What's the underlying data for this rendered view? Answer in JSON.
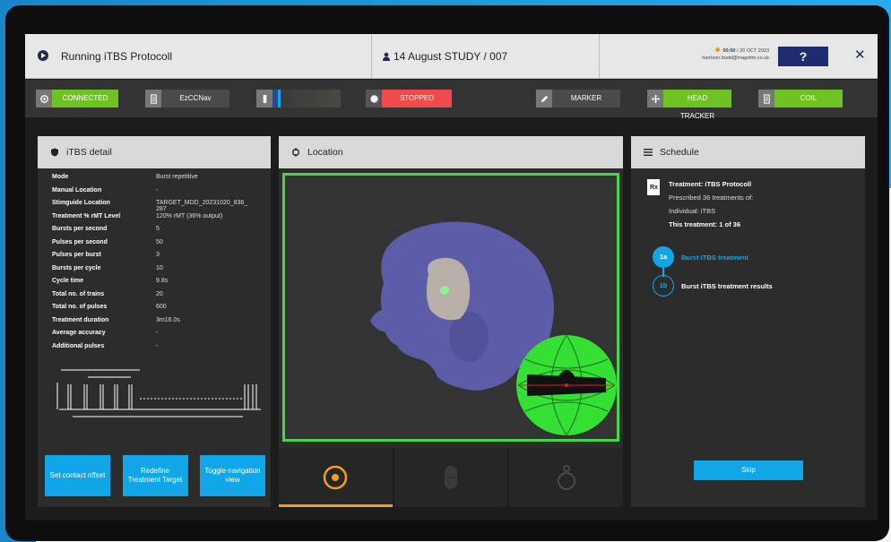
{
  "titlebar": {
    "title": "Running iTBS Protocoll",
    "study": "14 August STUDY / 007",
    "time": "00:50",
    "date": "20 OCT 2023",
    "email": "harrison.budd@magstim.co.uk",
    "help": "?",
    "close": "✕"
  },
  "statusbar": {
    "connected": "CONNECTED",
    "nav": "EzCCNav",
    "stopped": "STOPPED",
    "marker": "MARKER",
    "head_tracker": "HEAD TRACKER",
    "coil": "COIL",
    "colors": {
      "green": "#6ec222",
      "red": "#f04a4a",
      "dark": "#4a4a4a"
    }
  },
  "itbs": {
    "header": "iTBS detail",
    "rows": [
      {
        "k": "Mode",
        "v": "Burst repetitive"
      },
      {
        "k": "Manual Location",
        "v": "-"
      },
      {
        "k": "Stimguide Location",
        "v": "TARGET_MDD_20231020_836_ 287"
      },
      {
        "k": "Treatment % rMT Level",
        "v": "120% rMT (36% output)"
      },
      {
        "k": "Bursts per second",
        "v": "5"
      },
      {
        "k": "Pulses per second",
        "v": "50"
      },
      {
        "k": "Pulses per burst",
        "v": "3"
      },
      {
        "k": "Bursts per cycle",
        "v": "10"
      },
      {
        "k": "Cycle time",
        "v": "9.8s"
      },
      {
        "k": "Total no. of trains",
        "v": "20"
      },
      {
        "k": "Total no. of pulses",
        "v": "600"
      },
      {
        "k": "Treatment duration",
        "v": "3m16.0s"
      },
      {
        "k": "Average accuracy",
        "v": "-"
      },
      {
        "k": "Additional pulses",
        "v": "-"
      }
    ],
    "buttons": {
      "contact": "Set contact offset",
      "redefine": "Redefine Treatment Target",
      "toggle": "Toggle navigation view"
    }
  },
  "location": {
    "header": "Location"
  },
  "schedule": {
    "header": "Schedule",
    "treatment": "Treatment: iTBS Protocoll",
    "prescribed": "Prescribed 36 treatments of:",
    "individual": "Individual: iTBS",
    "this_treatment": "This treatment: 1 of 36",
    "steps": [
      {
        "id": "1a",
        "label": "Burst iTBS treatment"
      },
      {
        "id": "1b",
        "label": "Burst iTBS treatment results"
      }
    ],
    "skip": "Skip"
  }
}
